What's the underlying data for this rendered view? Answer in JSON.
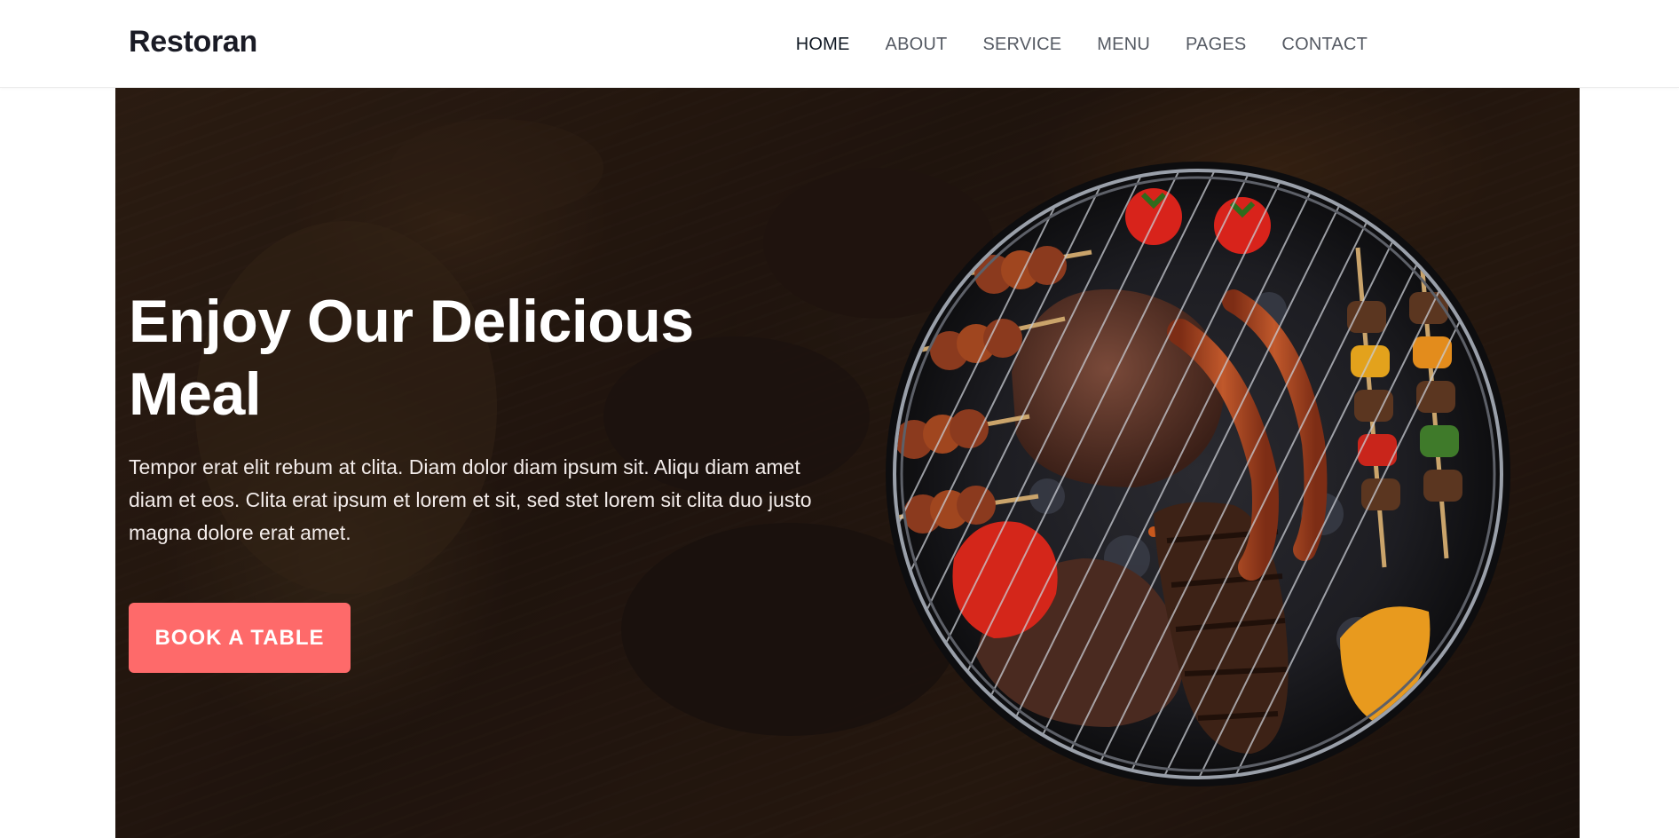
{
  "navbar": {
    "brand": "Restoran",
    "links": [
      {
        "label": "HOME",
        "active": true
      },
      {
        "label": "ABOUT",
        "active": false
      },
      {
        "label": "SERVICE",
        "active": false
      },
      {
        "label": "MENU",
        "active": false
      },
      {
        "label": "PAGES",
        "active": false
      },
      {
        "label": "CONTACT",
        "active": false
      }
    ]
  },
  "hero": {
    "title": "Enjoy Our Delicious Meal",
    "text": "Tempor erat elit rebum at clita. Diam dolor diam ipsum sit. Aliqu diam amet diam et eos. Clita erat ipsum et lorem et sit, sed stet lorem sit clita duo justo magna dolore erat amet.",
    "button_label": "BOOK A TABLE",
    "image": "grilled-meat-barbecue-image"
  },
  "colors": {
    "accent": "#fe6a6a",
    "brand_text": "#1a1b25",
    "nav_text": "#555a63",
    "nav_active": "#0f1722"
  }
}
